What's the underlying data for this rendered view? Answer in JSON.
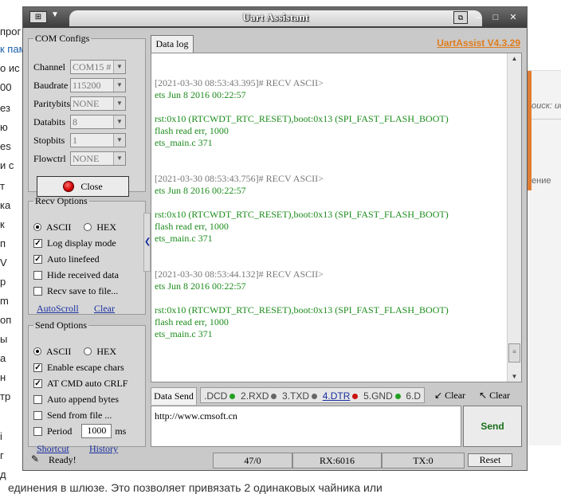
{
  "background": {
    "left_fragments": [
      "прог",
      "к пам",
      "о ис",
      "00",
      "ез",
      "ю",
      "es",
      "и с",
      "т",
      "ка",
      "к",
      "п",
      "V",
      "р",
      "m",
      "оп",
      "ы",
      "а",
      "н",
      "тр",
      "i",
      "г",
      "д"
    ],
    "bottom_text": "единения в шлюзе. Это позволяет привязать 2 одинаковых чайника или",
    "right_search": "оиск: uc",
    "right_label": "ение"
  },
  "window": {
    "title": "Uart Assistant",
    "brand": "UartAssist V4.3.29",
    "sys_icon": "⊞"
  },
  "com_configs": {
    "legend": "COM Configs",
    "fields": [
      {
        "label": "Channel",
        "value": "COM15 #"
      },
      {
        "label": "Baudrate",
        "value": "115200"
      },
      {
        "label": "Paritybits",
        "value": "NONE"
      },
      {
        "label": "Databits",
        "value": "8"
      },
      {
        "label": "Stopbits",
        "value": "1"
      },
      {
        "label": "Flowctrl",
        "value": "NONE"
      }
    ],
    "close_label": "Close"
  },
  "recv_options": {
    "legend": "Recv Options",
    "ascii": "ASCII",
    "hex": "HEX",
    "checks": [
      {
        "label": "Log display mode",
        "checked": true
      },
      {
        "label": "Auto linefeed",
        "checked": true
      },
      {
        "label": "Hide received data",
        "checked": false
      },
      {
        "label": "Recv save to file...",
        "checked": false
      }
    ],
    "autoscroll": "AutoScroll",
    "clear": "Clear"
  },
  "send_options": {
    "legend": "Send Options",
    "ascii": "ASCII",
    "hex": "HEX",
    "checks": [
      {
        "label": "Enable escape chars",
        "checked": true
      },
      {
        "label": "AT CMD auto CRLF",
        "checked": true
      },
      {
        "label": "Auto append bytes",
        "checked": false
      },
      {
        "label": "Send from file ...",
        "checked": false
      }
    ],
    "period_label": "Period",
    "period_value": "1000",
    "period_unit": "ms",
    "shortcut": "Shortcut",
    "history": "History"
  },
  "datalog": {
    "tab": "Data log",
    "entries": [
      {
        "header": "[2021-03-30 08:53:43.395]# RECV ASCII>",
        "line1": "ets Jun  8 2016 00:22:57",
        "line2": "rst:0x10 (RTCWDT_RTC_RESET),boot:0x13 (SPI_FAST_FLASH_BOOT)",
        "line3": "flash read err, 1000",
        "line4": "ets_main.c 371"
      },
      {
        "header": "[2021-03-30 08:53:43.756]# RECV ASCII>",
        "line1": "ets Jun  8 2016 00:22:57",
        "line2": "rst:0x10 (RTCWDT_RTC_RESET),boot:0x13 (SPI_FAST_FLASH_BOOT)",
        "line3": "flash read err, 1000",
        "line4": "ets_main.c 371"
      },
      {
        "header": "[2021-03-30 08:53:44.132]# RECV ASCII>",
        "line1": "ets Jun  8 2016 00:22:57",
        "line2": "rst:0x10 (RTCWDT_RTC_RESET),boot:0x13 (SPI_FAST_FLASH_BOOT)",
        "line3": "flash read err, 1000",
        "line4": "ets_main.c 371"
      }
    ]
  },
  "send_area": {
    "tab": "Data Send",
    "signals": [
      ".DCD",
      "2.RXD",
      "3.TXD",
      "4.DTR",
      "5.GND",
      "6.D"
    ],
    "signal_colors": [
      "#22a022",
      "#666666",
      "#666666",
      "#cc1111",
      "#22a022",
      "#22a022"
    ],
    "clear1": "Clear",
    "clear2": "Clear",
    "text": "http://www.cmsoft.cn",
    "send_label": "Send"
  },
  "status": {
    "ready": "Ready!",
    "count": "47/0",
    "rx": "RX:6016",
    "tx": "TX:0",
    "reset": "Reset"
  }
}
